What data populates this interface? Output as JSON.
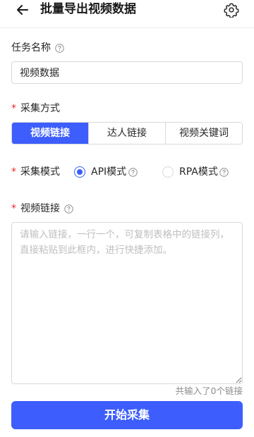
{
  "header": {
    "title": "批量导出视频数据",
    "back_icon": "arrow-left-icon",
    "settings_icon": "gear-icon"
  },
  "task_name": {
    "label": "任务名称",
    "value": "视频数据"
  },
  "collect_method": {
    "required_mark": "*",
    "label": "采集方式",
    "options": [
      "视频链接",
      "达人链接",
      "视频关键词"
    ],
    "selected": "视频链接"
  },
  "collect_mode": {
    "required_mark": "*",
    "label": "采集模式",
    "options": [
      {
        "label": "API模式",
        "checked": true
      },
      {
        "label": "RPA模式",
        "checked": false
      }
    ]
  },
  "video_links": {
    "required_mark": "*",
    "label": "视频链接",
    "placeholder": "请输入链接，一行一个，可复制表格中的链接列，直接粘贴到此框内，进行快捷添加。",
    "value": "",
    "count_text": "共输入了0个链接"
  },
  "start_button": {
    "label": "开始采集"
  },
  "colors": {
    "primary": "#3d5efc",
    "required": "#f5222d",
    "border": "#d9d9d9",
    "muted": "#8c8c8c"
  }
}
